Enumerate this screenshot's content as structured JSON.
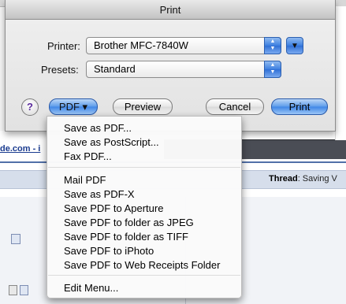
{
  "window": {
    "title": "Print"
  },
  "printer": {
    "label": "Printer:",
    "value": "Brother MFC-7840W"
  },
  "presets": {
    "label": "Presets:",
    "value": "Standard"
  },
  "buttons": {
    "help": "?",
    "pdf": "PDF ▾",
    "preview": "Preview",
    "cancel": "Cancel",
    "print": "Print"
  },
  "pdf_menu": {
    "group1": [
      "Save as PDF...",
      "Save as PostScript...",
      "Fax PDF..."
    ],
    "group2": [
      "Mail PDF",
      "Save as PDF-X",
      "Save PDF to Aperture",
      "Save PDF to folder as JPEG",
      "Save PDF to folder as TIFF",
      "Save PDF to iPhoto",
      "Save PDF to Web Receipts Folder"
    ],
    "group3": [
      "Edit Menu..."
    ]
  },
  "background": {
    "link_text": "de.com - i",
    "thread_label": "Thread",
    "thread_value": ": Saving V"
  },
  "colors": {
    "accent": "#3f86e6",
    "help_question": "#5a2a9c"
  }
}
